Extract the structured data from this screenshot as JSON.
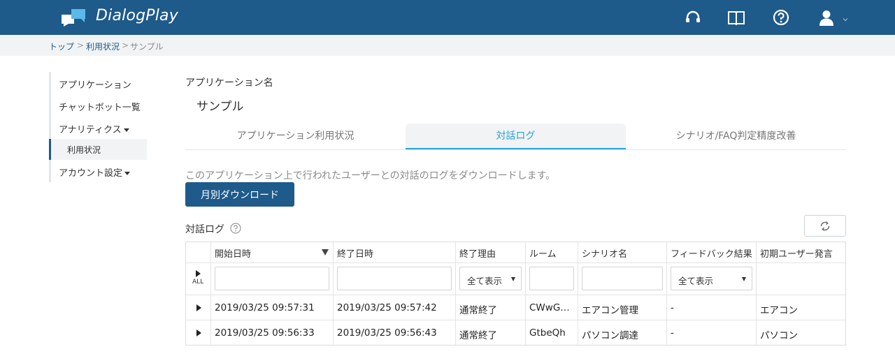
{
  "header": {
    "brand": "DialogPlay",
    "icons": [
      "support-icon",
      "manual-icon",
      "help-icon",
      "user-icon"
    ]
  },
  "breadcrumb": {
    "items": [
      "トップ",
      "利用状況",
      "サンプル"
    ],
    "separator": ">"
  },
  "sidebar": {
    "items": [
      {
        "label": "アプリケーション"
      },
      {
        "label": "チャットボット一覧"
      },
      {
        "label": "アナリティクス"
      },
      {
        "label": "利用状況"
      },
      {
        "label": "アカウント設定"
      }
    ]
  },
  "main": {
    "app_label": "アプリケーション名",
    "app_name": "サンプル",
    "tabs": [
      {
        "label": "アプリケーション利用状況"
      },
      {
        "label": "対話ログ"
      },
      {
        "label": "シナリオ/FAQ判定精度改善"
      }
    ],
    "active_tab": "対話ログ",
    "description": "このアプリケーション上で行われたユーザーとの対話のログをダウンロードします。",
    "download_button": "月別ダウンロード",
    "section_title": "対話ログ"
  },
  "table": {
    "columns": [
      "開始日時",
      "終了日時",
      "終了理由",
      "ルーム",
      "シナリオ名",
      "フィードバック結果",
      "初期ユーザー発言"
    ],
    "expand_all_label": "ALL",
    "filters": {
      "end_reason": "全て表示",
      "feedback": "全て表示"
    },
    "rows": [
      {
        "start": "2019/03/25 09:57:31",
        "end": "2019/03/25 09:57:42",
        "reason": "通常終了",
        "room": "CWwG…",
        "scenario": "エアコン管理",
        "feedback": "-",
        "first_utterance": "エアコン"
      },
      {
        "start": "2019/03/25 09:56:33",
        "end": "2019/03/25 09:56:43",
        "reason": "通常終了",
        "room": "GtbeQh",
        "scenario": "パソコン調達",
        "feedback": "-",
        "first_utterance": "パソコン"
      }
    ]
  },
  "colors": {
    "header_bg": "#1e5a8a",
    "accent": "#29a3d8",
    "breadcrumb_bg": "#f1f3f5"
  }
}
